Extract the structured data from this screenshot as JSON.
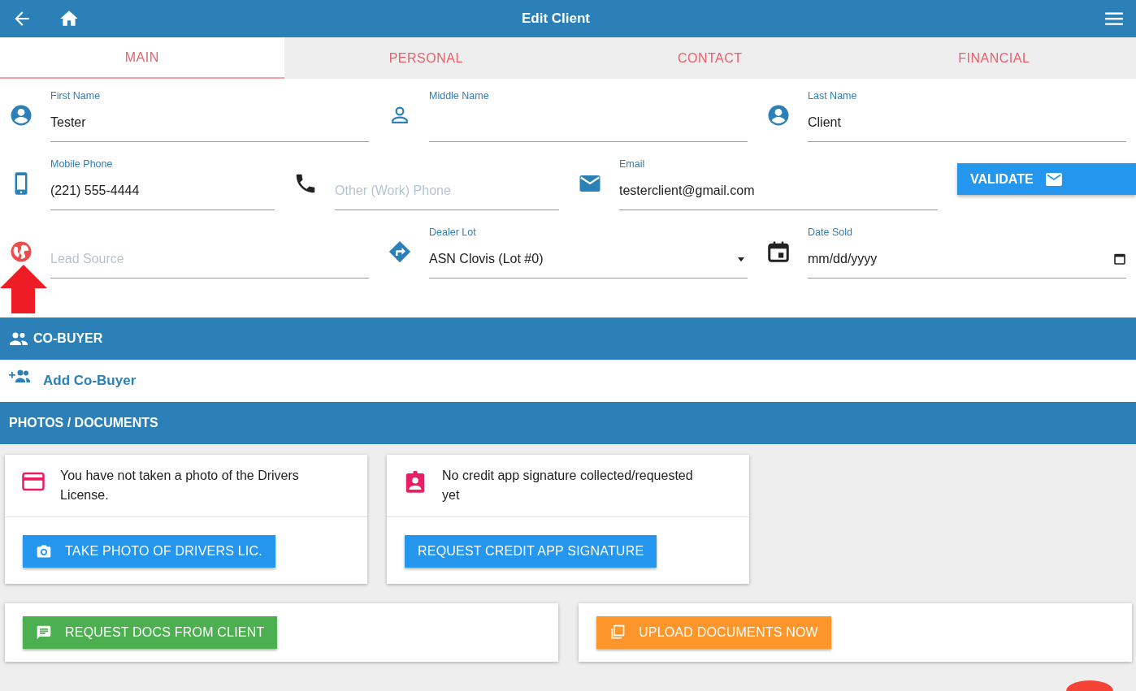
{
  "header": {
    "title": "Edit Client"
  },
  "tabs": [
    {
      "label": "MAIN",
      "selected": true
    },
    {
      "label": "PERSONAL",
      "selected": false
    },
    {
      "label": "CONTACT",
      "selected": false
    },
    {
      "label": "FINANCIAL",
      "selected": false
    }
  ],
  "form_rows": [
    {
      "fields": [
        {
          "kind": "text",
          "label": "First Name",
          "value": "Tester"
        },
        {
          "kind": "text",
          "label": "Middle Name"
        },
        {
          "kind": "text",
          "label": "Last Name",
          "value": "Client"
        }
      ]
    },
    {
      "fields": [
        {
          "kind": "text",
          "label": "Mobile Phone",
          "value": "(221) 555-4444"
        },
        {
          "kind": "text",
          "placeholder": "Other (Work) Phone"
        },
        {
          "kind": "text",
          "label": "Email",
          "value": "testerclient@gmail.com"
        },
        {
          "kind": "button",
          "label": "VALIDATE"
        }
      ]
    },
    {
      "fields": [
        {
          "kind": "text",
          "placeholder": "Lead Source"
        },
        {
          "kind": "select",
          "label": "Dealer Lot",
          "value": "ASN Clovis (Lot #0)"
        },
        {
          "kind": "date",
          "label": "Date Sold",
          "value": "mm/dd/yyyy"
        }
      ]
    }
  ],
  "co_buyer": {
    "title": "CO-BUYER",
    "action": "Add Co-Buyer"
  },
  "documents": {
    "title": "PHOTOS / DOCUMENTS",
    "cards": [
      {
        "kind": "license",
        "message": "You have not taken a photo of the Drivers License.",
        "button": "TAKE PHOTO OF DRIVERS LIC."
      },
      {
        "kind": "signature",
        "message": "No credit app signature collected/requested yet",
        "button": "REQUEST CREDIT APP SIGNATURE"
      }
    ],
    "actions": [
      {
        "kind": "request",
        "button": "REQUEST DOCS FROM CLIENT"
      },
      {
        "kind": "upload",
        "button": "UPLOAD DOCUMENTS NOW"
      }
    ]
  }
}
